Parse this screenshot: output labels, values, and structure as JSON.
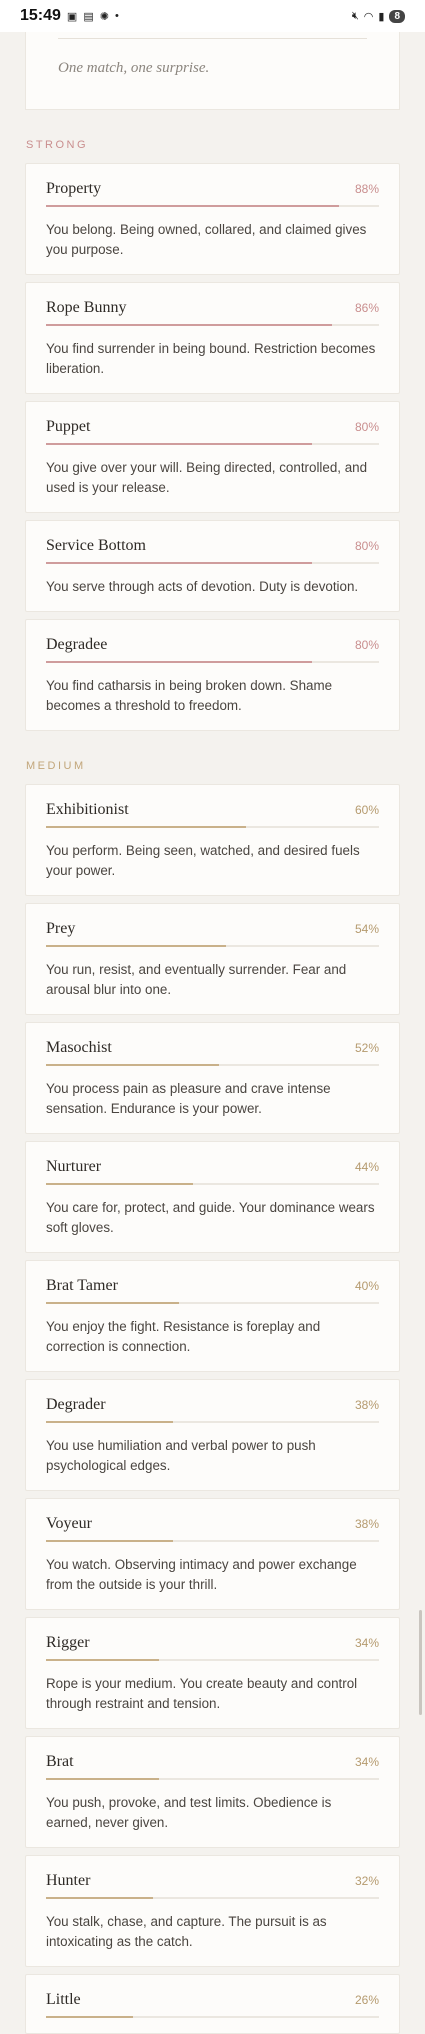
{
  "status_bar": {
    "time": "15:49",
    "left_icons": [
      "notification-icon",
      "message-icon",
      "weather-icon",
      "dot-icon"
    ],
    "right_icons": [
      "mute-icon",
      "wifi-icon",
      "signal-icon"
    ],
    "battery": "8"
  },
  "top_card": {
    "caption": "One match, one surprise."
  },
  "sections": [
    {
      "label": "STRONG",
      "items": [
        {
          "title": "Property",
          "percent_label": "88%",
          "percent": 88,
          "description": "You belong. Being owned, collared, and claimed gives you purpose."
        },
        {
          "title": "Rope Bunny",
          "percent_label": "86%",
          "percent": 86,
          "description": "You find surrender in being bound. Restriction becomes liberation."
        },
        {
          "title": "Puppet",
          "percent_label": "80%",
          "percent": 80,
          "description": "You give over your will. Being directed, controlled, and used is your release."
        },
        {
          "title": "Service Bottom",
          "percent_label": "80%",
          "percent": 80,
          "description": "You serve through acts of devotion. Duty is devotion."
        },
        {
          "title": "Degradee",
          "percent_label": "80%",
          "percent": 80,
          "description": "You find catharsis in being broken down. Shame becomes a threshold to freedom."
        }
      ]
    },
    {
      "label": "MEDIUM",
      "items": [
        {
          "title": "Exhibitionist",
          "percent_label": "60%",
          "percent": 60,
          "description": "You perform. Being seen, watched, and desired fuels your power."
        },
        {
          "title": "Prey",
          "percent_label": "54%",
          "percent": 54,
          "description": "You run, resist, and eventually surrender. Fear and arousal blur into one."
        },
        {
          "title": "Masochist",
          "percent_label": "52%",
          "percent": 52,
          "description": "You process pain as pleasure and crave intense sensation. Endurance is your power."
        },
        {
          "title": "Nurturer",
          "percent_label": "44%",
          "percent": 44,
          "description": "You care for, protect, and guide. Your dominance wears soft gloves."
        },
        {
          "title": "Brat Tamer",
          "percent_label": "40%",
          "percent": 40,
          "description": "You enjoy the fight. Resistance is foreplay and correction is connection."
        },
        {
          "title": "Degrader",
          "percent_label": "38%",
          "percent": 38,
          "description": "You use humiliation and verbal power to push psychological edges."
        },
        {
          "title": "Voyeur",
          "percent_label": "38%",
          "percent": 38,
          "description": "You watch. Observing intimacy and power exchange from the outside is your thrill."
        },
        {
          "title": "Rigger",
          "percent_label": "34%",
          "percent": 34,
          "description": "Rope is your medium. You create beauty and control through restraint and tension."
        },
        {
          "title": "Brat",
          "percent_label": "34%",
          "percent": 34,
          "description": "You push, provoke, and test limits. Obedience is earned, never given."
        },
        {
          "title": "Hunter",
          "percent_label": "32%",
          "percent": 32,
          "description": "You stalk, chase, and capture. The pursuit is as intoxicating as the catch."
        },
        {
          "title": "Little",
          "percent_label": "26%",
          "percent": 26,
          "description": ""
        }
      ]
    }
  ],
  "colors": {
    "strong_accent": "#c98e8e",
    "medium_accent": "#c2a67a",
    "background": "#f4f2ee"
  }
}
